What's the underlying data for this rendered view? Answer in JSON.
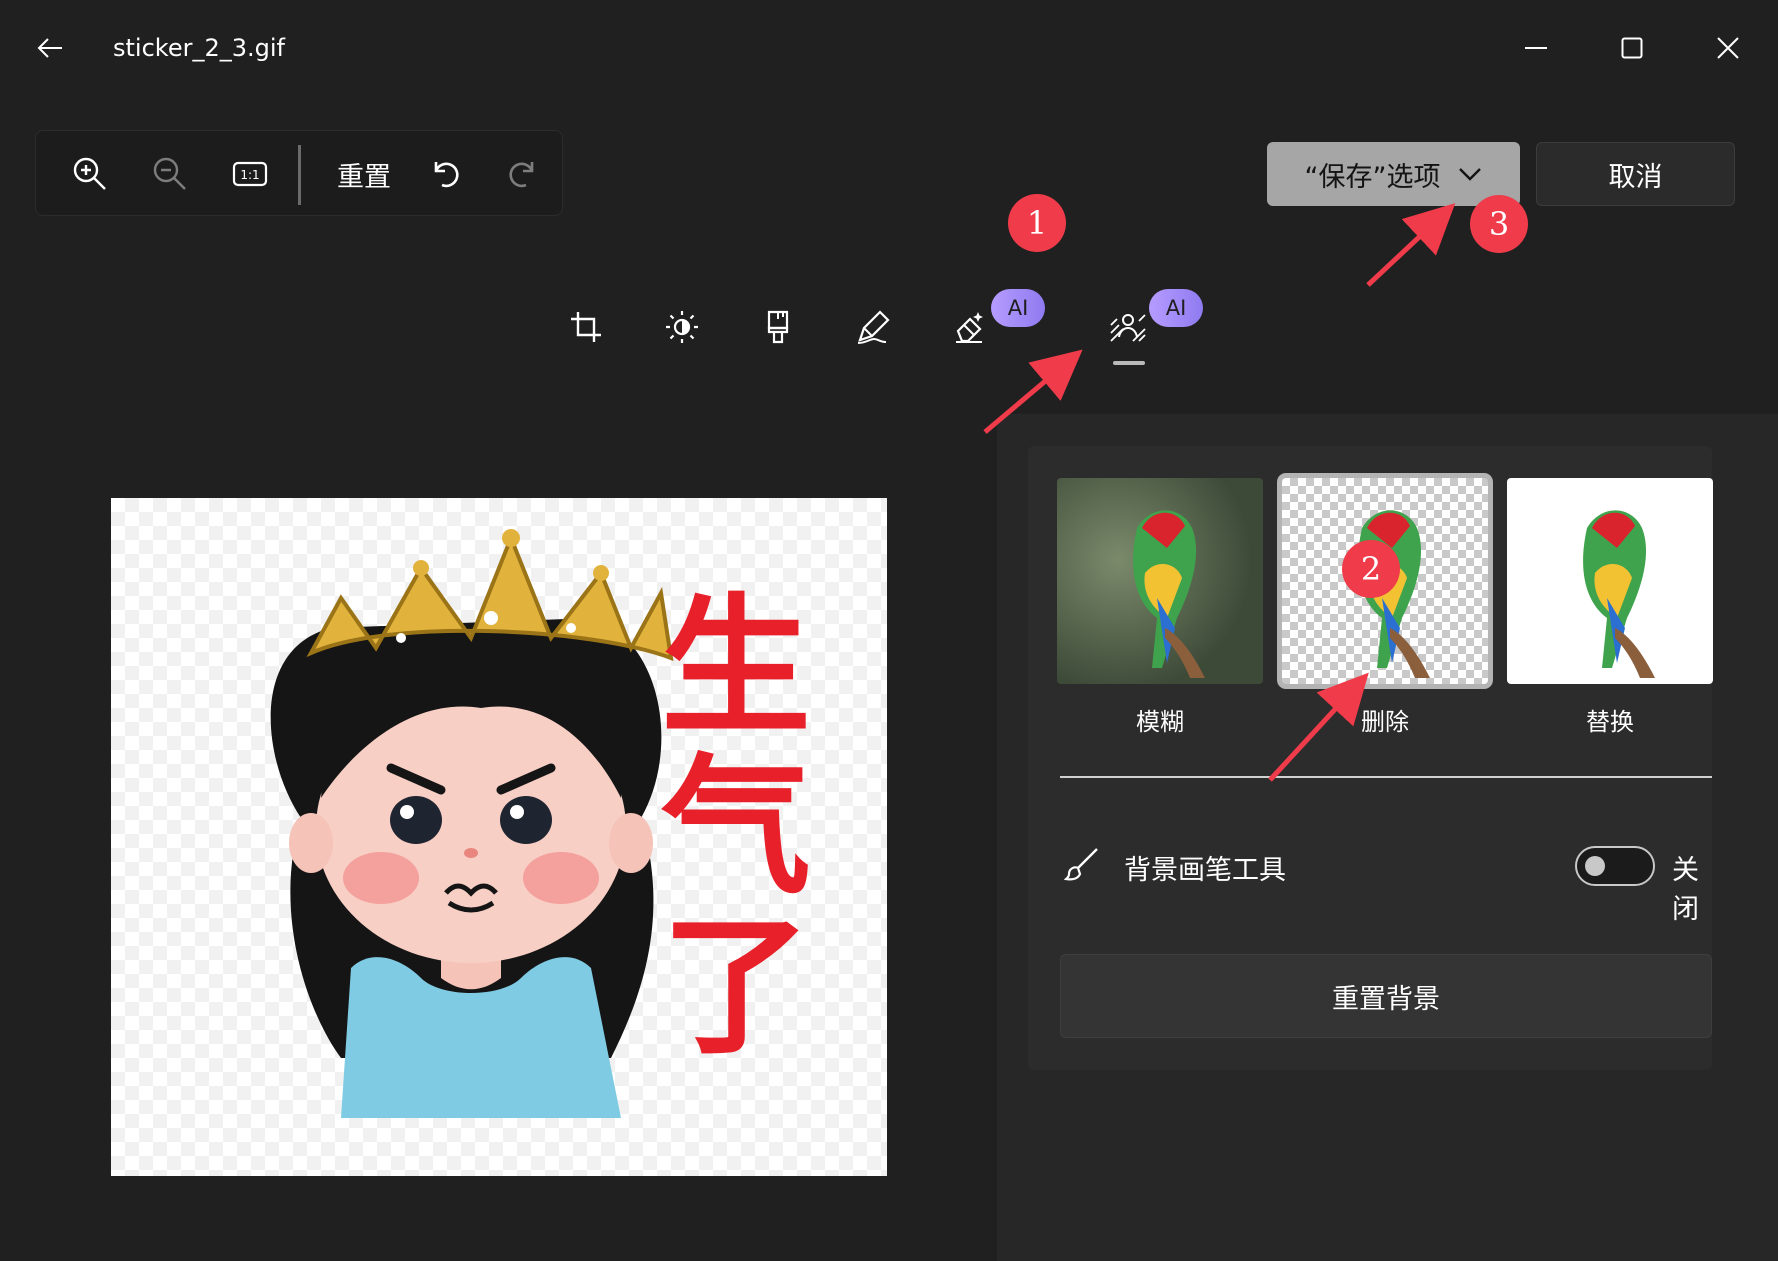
{
  "titlebar": {
    "file_name": "sticker_2_3.gif",
    "back_icon": "arrow-left-icon",
    "minimize_icon": "minimize-icon",
    "maximize_icon": "maximize-icon",
    "close_icon": "close-icon"
  },
  "zoom_toolbar": {
    "zoom_in_icon": "zoom-in-icon",
    "zoom_out_icon": "zoom-out-icon",
    "actual_size_icon": "actual-size-icon",
    "actual_size_text": "1:1",
    "reset_label": "重置",
    "undo_icon": "undo-icon",
    "redo_icon": "redo-icon"
  },
  "actions": {
    "save_options_label": "“保存”选项",
    "cancel_label": "取消"
  },
  "edit_tools": {
    "items": [
      {
        "icon": "crop-icon",
        "badge": ""
      },
      {
        "icon": "adjust-brightness-icon",
        "badge": ""
      },
      {
        "icon": "filter-brush-icon",
        "badge": ""
      },
      {
        "icon": "markup-pen-icon",
        "badge": ""
      },
      {
        "icon": "generative-erase-icon",
        "badge": "AI"
      },
      {
        "icon": "background-icon",
        "badge": "AI"
      }
    ],
    "selected": "background-icon"
  },
  "canvas": {
    "sticker_text": [
      "生",
      "气",
      "了"
    ]
  },
  "background_panel": {
    "options": [
      {
        "label": "模糊",
        "state": "blur"
      },
      {
        "label": "删除",
        "state": "remove",
        "selected": true
      },
      {
        "label": "替换",
        "state": "replace"
      }
    ],
    "brush_tool_label": "背景画笔工具",
    "brush_icon": "paintbrush-icon",
    "brush_toggle_label": "关闭",
    "brush_toggle_on": false,
    "reset_background_label": "重置背景"
  },
  "annotations": {
    "markers": [
      "1",
      "2",
      "3"
    ],
    "color": "#ef3b4a"
  },
  "colors": {
    "window_bg": "#202020",
    "panel_bg": "#2c2c2c",
    "save_button_bg": "#a6a6a6",
    "ai_badge": "#a48cff"
  }
}
